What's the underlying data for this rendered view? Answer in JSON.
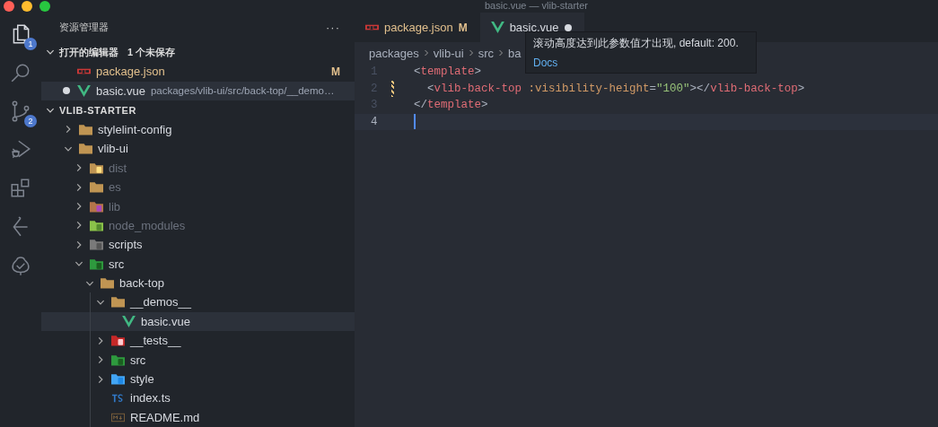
{
  "window": {
    "title": "basic.vue — vlib-starter"
  },
  "activity_bar": [
    {
      "badge": "1",
      "selected": true
    },
    {
      "selected": false
    },
    {
      "badge": "2",
      "selected": false
    },
    {
      "selected": false
    },
    {
      "selected": false
    },
    {
      "selected": false
    },
    {
      "selected": false
    }
  ],
  "sidebar": {
    "title": "资源管理器",
    "more": "···",
    "open_editors": {
      "title": "打开的编辑器",
      "note": "1 个未保存",
      "expanded": true,
      "items": [
        {
          "name": "package.json",
          "kind": "npm",
          "status": "M",
          "dirty": false,
          "selected": false
        },
        {
          "name": "basic.vue",
          "kind": "vue",
          "description": "packages/vlib-ui/src/back-top/__demo…",
          "dirty": true,
          "selected": true
        }
      ]
    },
    "project": {
      "title": "VLIB-STARTER",
      "expanded": true,
      "tree": [
        {
          "name": "stylelint-config",
          "kind": "folder",
          "expanded": false,
          "ignored": false,
          "selected": false
        },
        {
          "name": "vlib-ui",
          "kind": "folder",
          "expanded": true,
          "ignored": false,
          "selected": false,
          "children": [
            {
              "name": "dist",
              "kind": "dist",
              "expanded": false,
              "ignored": true,
              "selected": false
            },
            {
              "name": "es",
              "kind": "folder",
              "expanded": false,
              "ignored": true,
              "selected": false
            },
            {
              "name": "lib",
              "kind": "lib",
              "expanded": false,
              "ignored": true,
              "selected": false
            },
            {
              "name": "node_modules",
              "kind": "node",
              "expanded": false,
              "ignored": true,
              "selected": false
            },
            {
              "name": "scripts",
              "kind": "scripts",
              "expanded": false,
              "ignored": false,
              "selected": false
            },
            {
              "name": "src",
              "kind": "src",
              "expanded": true,
              "ignored": false,
              "selected": false,
              "children": [
                {
                  "name": "back-top",
                  "kind": "folder",
                  "expanded": true,
                  "ignored": false,
                  "selected": false,
                  "children": [
                    {
                      "name": "__demos__",
                      "kind": "folder",
                      "expanded": true,
                      "ignored": false,
                      "selected": false,
                      "children": [
                        {
                          "name": "basic.vue",
                          "kind": "vue",
                          "ignored": false,
                          "selected": true
                        }
                      ]
                    },
                    {
                      "name": "__tests__",
                      "kind": "tests",
                      "expanded": false,
                      "ignored": false,
                      "selected": false
                    },
                    {
                      "name": "src",
                      "kind": "src",
                      "expanded": false,
                      "ignored": false,
                      "selected": false
                    },
                    {
                      "name": "style",
                      "kind": "style",
                      "expanded": false,
                      "ignored": false,
                      "selected": false
                    },
                    {
                      "name": "index.ts",
                      "kind": "ts",
                      "ignored": false,
                      "selected": false
                    },
                    {
                      "name": "README.md",
                      "kind": "md",
                      "ignored": false,
                      "selected": false
                    }
                  ]
                }
              ]
            }
          ]
        }
      ]
    }
  },
  "tabs": [
    {
      "label": "package.json",
      "kind": "npm",
      "status": "M",
      "dirty": false,
      "selected": false
    },
    {
      "label": "basic.vue",
      "kind": "vue",
      "dirty": true,
      "selected": true
    }
  ],
  "breadcrumbs": [
    "packages",
    "vlib-ui",
    "src",
    "ba"
  ],
  "hover": {
    "text": "滚动高度达到此参数值才出现, default: 200.",
    "link": "Docs"
  },
  "code": [
    {
      "number": "1",
      "current": false,
      "modified": false,
      "tokens": [
        {
          "kind": "punct",
          "text": "<"
        },
        {
          "kind": "tag",
          "text": "template"
        },
        {
          "kind": "punct",
          "text": ">"
        }
      ]
    },
    {
      "number": "2",
      "current": false,
      "modified": true,
      "tokens": [
        {
          "kind": "punct",
          "text": "  <"
        },
        {
          "kind": "tag",
          "text": "vlib-back-top"
        },
        {
          "kind": "attr",
          "text": " :visibility-height"
        },
        {
          "kind": "punct",
          "text": "="
        },
        {
          "kind": "string",
          "text": "\"100\""
        },
        {
          "kind": "punct",
          "text": "></"
        },
        {
          "kind": "tag",
          "text": "vlib-back-top"
        },
        {
          "kind": "punct",
          "text": ">"
        }
      ]
    },
    {
      "number": "3",
      "current": false,
      "modified": false,
      "tokens": [
        {
          "kind": "punct",
          "text": "</"
        },
        {
          "kind": "tag",
          "text": "template"
        },
        {
          "kind": "punct",
          "text": ">"
        }
      ]
    },
    {
      "number": "4",
      "current": true,
      "modified": false
    }
  ]
}
